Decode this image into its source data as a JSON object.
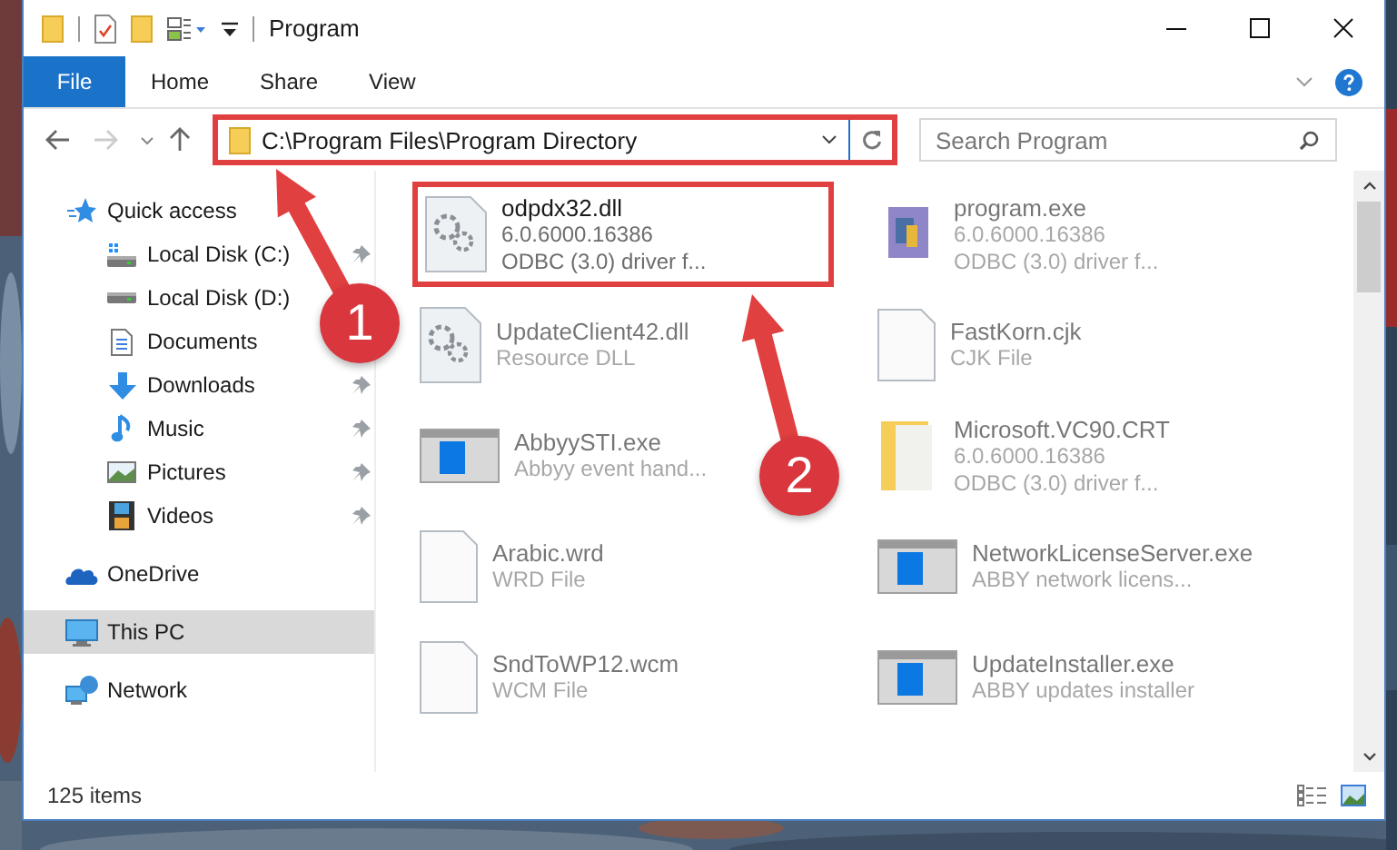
{
  "window": {
    "title": "Program"
  },
  "ribbon_tabs": [
    {
      "label": "File",
      "selected": true
    },
    {
      "label": "Home",
      "selected": false
    },
    {
      "label": "Share",
      "selected": false
    },
    {
      "label": "View",
      "selected": false
    }
  ],
  "address": {
    "path": "C:\\Program Files\\Program Directory"
  },
  "search": {
    "placeholder": "Search Program"
  },
  "sidebar": {
    "items": [
      {
        "label": "Quick access",
        "kind": "section",
        "pinned": false,
        "selected": false
      },
      {
        "label": "Local Disk (C:)",
        "kind": "place",
        "pinned": true,
        "selected": false
      },
      {
        "label": "Local Disk (D:)",
        "kind": "place",
        "pinned": false,
        "selected": false
      },
      {
        "label": "Documents",
        "kind": "place",
        "pinned": false,
        "selected": false
      },
      {
        "label": "Downloads",
        "kind": "place",
        "pinned": true,
        "selected": false
      },
      {
        "label": "Music",
        "kind": "place",
        "pinned": true,
        "selected": false
      },
      {
        "label": "Pictures",
        "kind": "place",
        "pinned": true,
        "selected": false
      },
      {
        "label": "Videos",
        "kind": "place",
        "pinned": true,
        "selected": false
      },
      {
        "label": "OneDrive",
        "kind": "section",
        "pinned": false,
        "selected": false
      },
      {
        "label": "This PC",
        "kind": "section",
        "pinned": false,
        "selected": true
      },
      {
        "label": "Network",
        "kind": "section",
        "pinned": false,
        "selected": false
      }
    ]
  },
  "files": [
    {
      "name": "odpdx32.dll",
      "details": [
        "6.0.6000.16386",
        "ODBC (3.0) driver f..."
      ],
      "kind": "library",
      "highlighted": true
    },
    {
      "name": "program.exe",
      "details": [
        "6.0.6000.16386",
        "ODBC (3.0) driver f..."
      ],
      "kind": "installer",
      "highlighted": false
    },
    {
      "name": "UpdateClient42.dll",
      "details": [
        "Resource DLL"
      ],
      "kind": "library",
      "highlighted": false
    },
    {
      "name": "FastKorn.cjk",
      "details": [
        "CJK File"
      ],
      "kind": "file",
      "highlighted": false
    },
    {
      "name": "AbbyySTI.exe",
      "details": [
        "Abbyy event hand..."
      ],
      "kind": "application",
      "highlighted": false
    },
    {
      "name": "Microsoft.VC90.CRT",
      "details": [
        "6.0.6000.16386",
        "ODBC (3.0) driver f..."
      ],
      "kind": "folder",
      "highlighted": false
    },
    {
      "name": "Arabic.wrd",
      "details": [
        "WRD File"
      ],
      "kind": "file",
      "highlighted": false
    },
    {
      "name": "NetworkLicenseServer.exe",
      "details": [
        "ABBY network licens..."
      ],
      "kind": "application",
      "highlighted": false
    },
    {
      "name": "SndToWP12.wcm",
      "details": [
        "WCM File"
      ],
      "kind": "file",
      "highlighted": false
    },
    {
      "name": "UpdateInstaller.exe",
      "details": [
        "ABBY updates installer"
      ],
      "kind": "application",
      "highlighted": false
    }
  ],
  "status_bar": {
    "count": "125 items"
  },
  "callouts": [
    {
      "number": "1"
    },
    {
      "number": "2"
    }
  ]
}
